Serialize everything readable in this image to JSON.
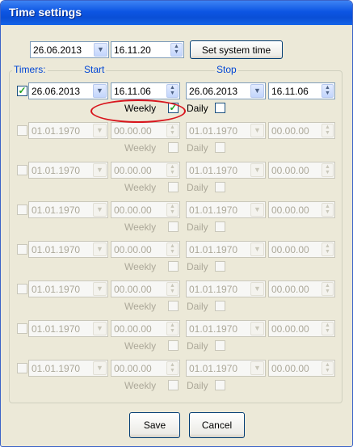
{
  "window": {
    "title": "Time settings"
  },
  "system": {
    "date": "26.06.2013",
    "time": "16.11.20",
    "set_button": "Set system time"
  },
  "timers": {
    "label": "Timers:",
    "start_label": "Start",
    "stop_label": "Stop",
    "weekly_label": "Weekly",
    "daily_label": "Daily",
    "rows": [
      {
        "enabled": true,
        "start_date": "26.06.2013",
        "start_time": "16.11.06",
        "stop_date": "26.06.2013",
        "stop_time": "16.11.06",
        "weekly": true,
        "daily": false
      },
      {
        "enabled": false,
        "start_date": "01.01.1970",
        "start_time": "00.00.00",
        "stop_date": "01.01.1970",
        "stop_time": "00.00.00",
        "weekly": false,
        "daily": false
      },
      {
        "enabled": false,
        "start_date": "01.01.1970",
        "start_time": "00.00.00",
        "stop_date": "01.01.1970",
        "stop_time": "00.00.00",
        "weekly": false,
        "daily": false
      },
      {
        "enabled": false,
        "start_date": "01.01.1970",
        "start_time": "00.00.00",
        "stop_date": "01.01.1970",
        "stop_time": "00.00.00",
        "weekly": false,
        "daily": false
      },
      {
        "enabled": false,
        "start_date": "01.01.1970",
        "start_time": "00.00.00",
        "stop_date": "01.01.1970",
        "stop_time": "00.00.00",
        "weekly": false,
        "daily": false
      },
      {
        "enabled": false,
        "start_date": "01.01.1970",
        "start_time": "00.00.00",
        "stop_date": "01.01.1970",
        "stop_time": "00.00.00",
        "weekly": false,
        "daily": false
      },
      {
        "enabled": false,
        "start_date": "01.01.1970",
        "start_time": "00.00.00",
        "stop_date": "01.01.1970",
        "stop_time": "00.00.00",
        "weekly": false,
        "daily": false
      },
      {
        "enabled": false,
        "start_date": "01.01.1970",
        "start_time": "00.00.00",
        "stop_date": "01.01.1970",
        "stop_time": "00.00.00",
        "weekly": false,
        "daily": false
      }
    ]
  },
  "footer": {
    "save_label": "Save",
    "cancel_label": "Cancel"
  },
  "icons": {
    "dropdown": "chevron-down-icon",
    "spinner": "spinner-icon",
    "check": "checkmark-icon"
  },
  "colors": {
    "title_bar": "#0c55e3",
    "annotation_circle": "#d8151d",
    "check_mark": "#21a121"
  }
}
